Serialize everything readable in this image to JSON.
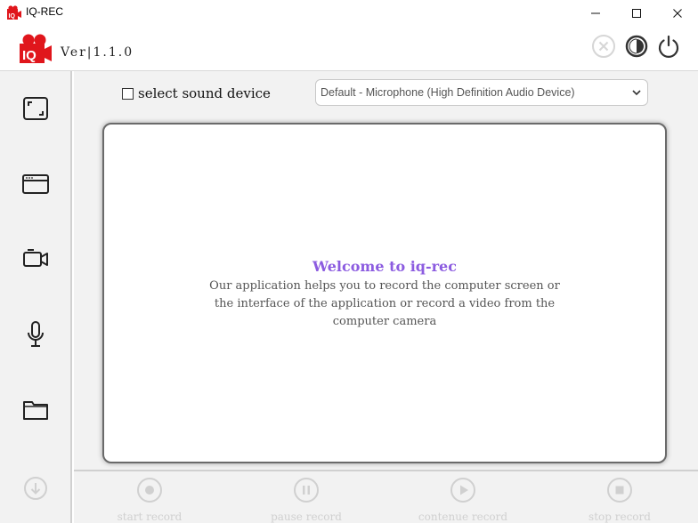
{
  "window": {
    "title": "IQ-REC",
    "minimize_icon": "minimize-icon",
    "maximize_icon": "maximize-icon",
    "close_icon": "close-icon"
  },
  "header": {
    "logo_text": "IQ",
    "version": "Ver|1.1.0",
    "buttons": [
      "cancel-icon",
      "theme-toggle-icon",
      "power-icon"
    ]
  },
  "sidebar": {
    "items": [
      "fullscreen-capture-icon",
      "window-capture-icon",
      "camera-icon",
      "microphone-icon",
      "folder-icon",
      "download-icon"
    ]
  },
  "sound": {
    "checkbox_label": "select sound device",
    "checked": false,
    "selected_device": "Default - Microphone (High Definition Audio Device)"
  },
  "preview": {
    "title": "Welcome to iq-rec",
    "description": "Our application helps you to record the computer screen or the interface of the application or record a video from the computer camera"
  },
  "controls": {
    "start": "start record",
    "pause": "pause record",
    "continue": "contenue record",
    "stop": "stop record"
  },
  "colors": {
    "brand_red": "#e0161c",
    "accent_purple": "#8c5ce0",
    "panel_bg": "#f2f2f2",
    "disabled": "#d0d0d0"
  }
}
